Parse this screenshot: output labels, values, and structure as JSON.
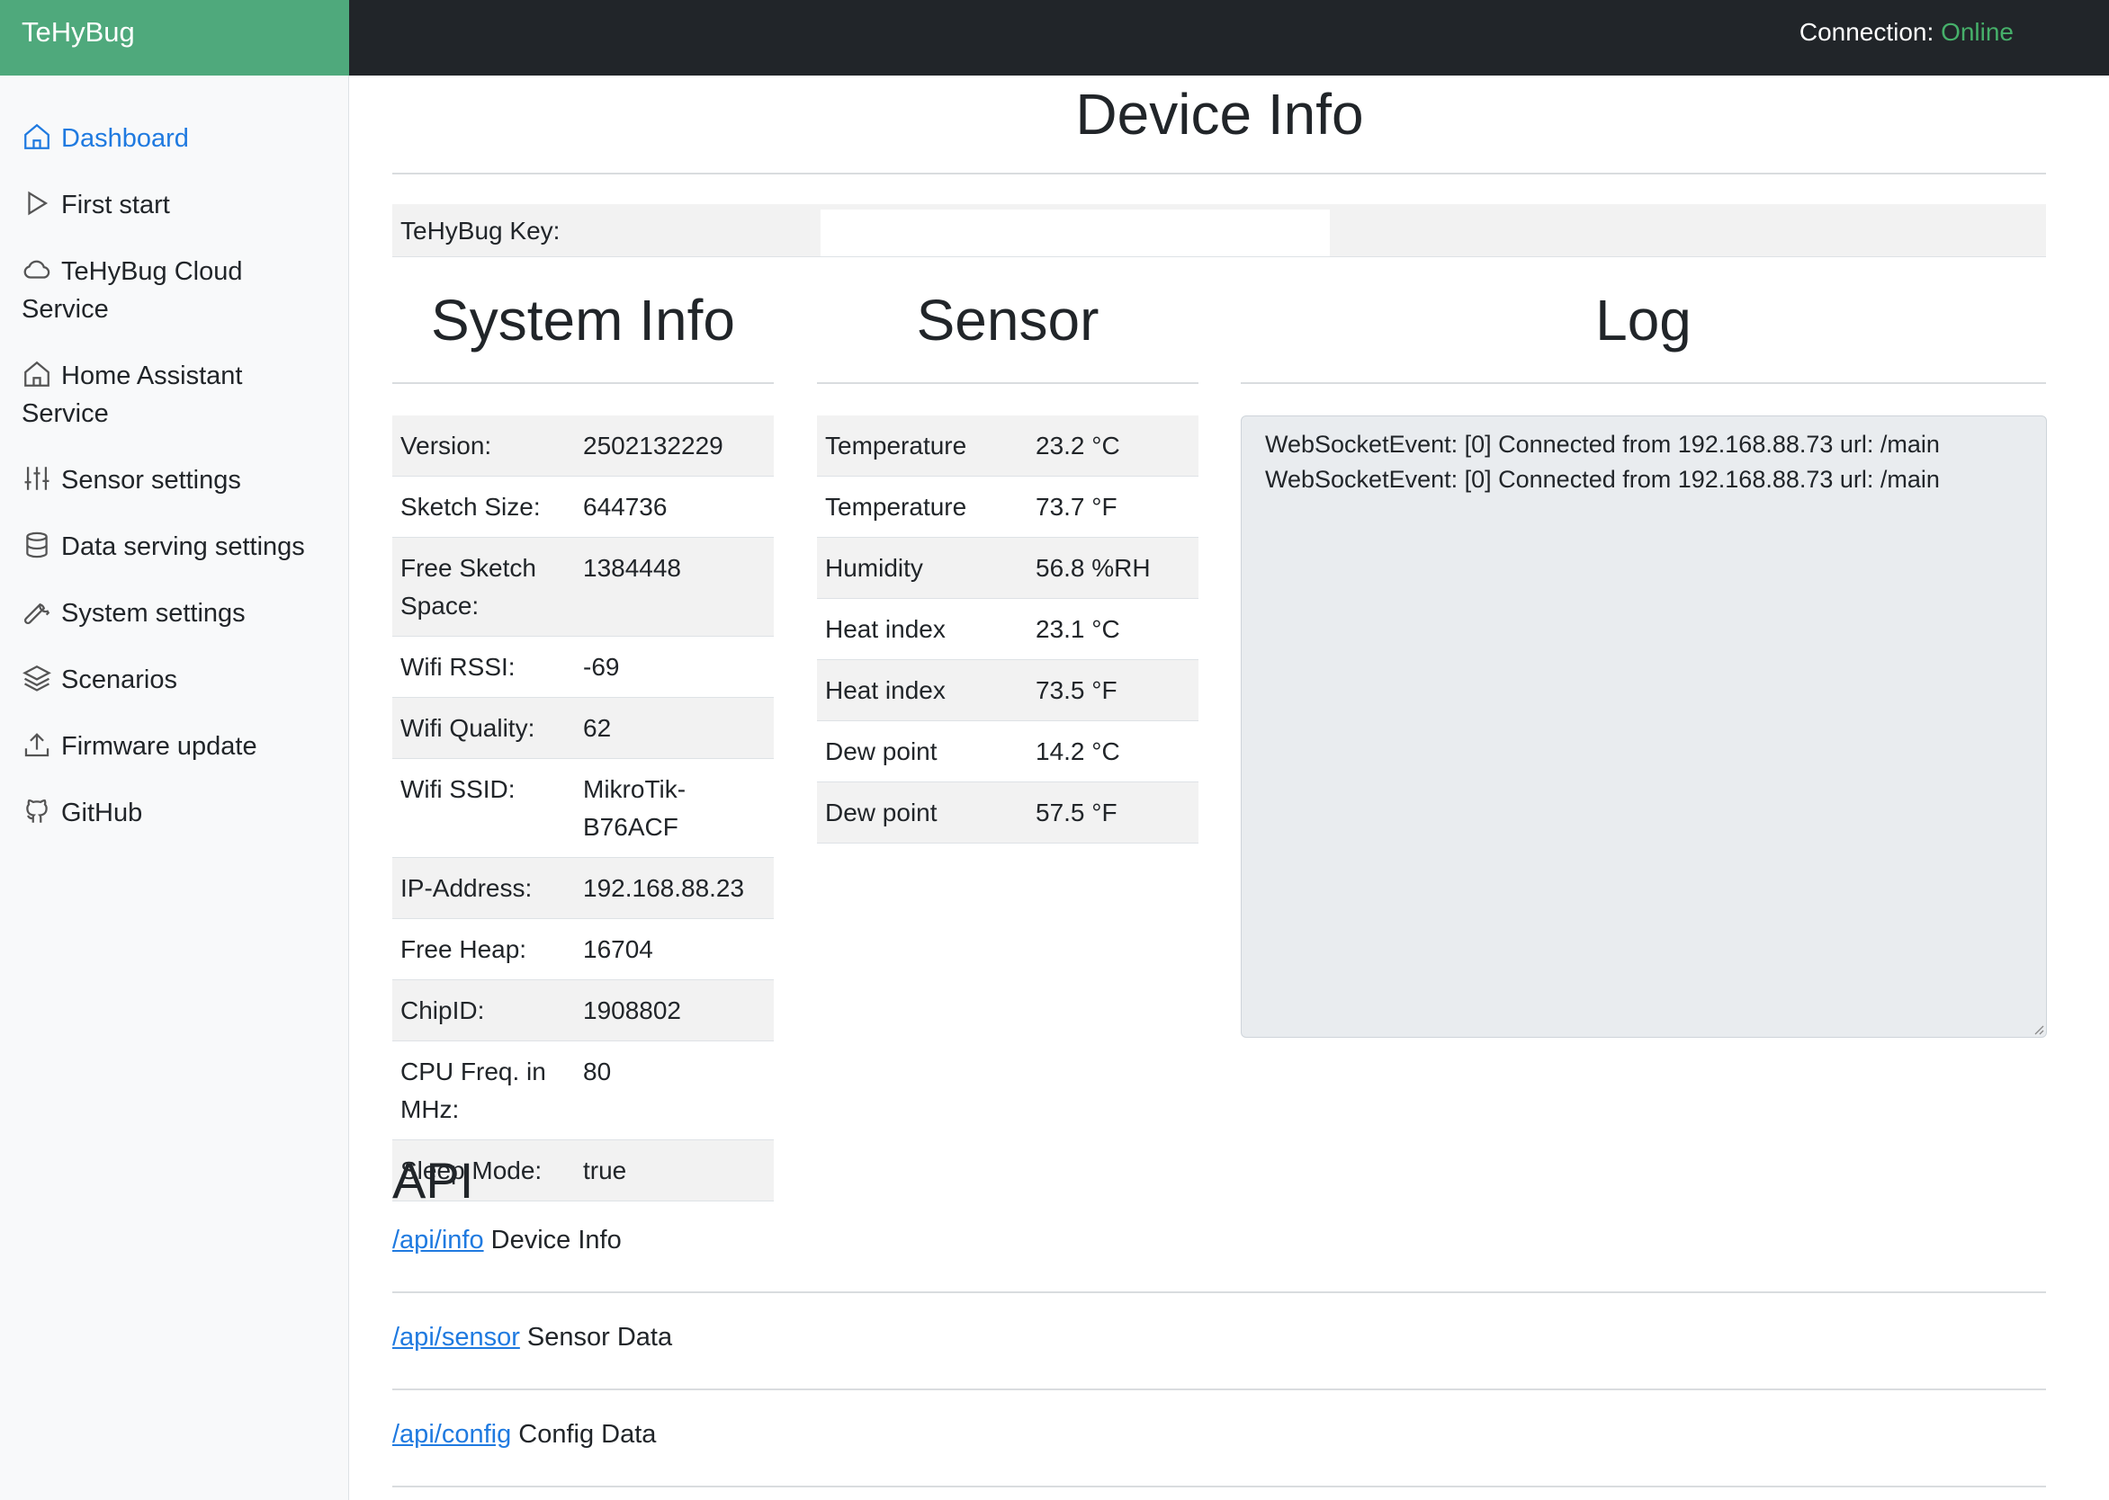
{
  "header": {
    "brand": "TeHyBug",
    "connection_label": "Connection:",
    "connection_status": "Online",
    "status_color": "#46b06a"
  },
  "sidebar": {
    "items": [
      {
        "label": "Dashboard",
        "icon": "home-icon",
        "active": true
      },
      {
        "label": "First start",
        "icon": "play-icon"
      },
      {
        "label_line1": "TeHyBug Cloud",
        "label_line2": "Service",
        "icon": "cloud-icon"
      },
      {
        "label_line1": "Home Assistant",
        "label_line2": "Service",
        "icon": "home-icon"
      },
      {
        "label": "Sensor settings",
        "icon": "sliders-icon"
      },
      {
        "label": "Data serving settings",
        "icon": "database-icon"
      },
      {
        "label": "System settings",
        "icon": "wrench-icon"
      },
      {
        "label": "Scenarios",
        "icon": "layers-icon"
      },
      {
        "label": "Firmware update",
        "icon": "upload-icon"
      },
      {
        "label": "GitHub",
        "icon": "github-icon"
      }
    ]
  },
  "main": {
    "title": "Device Info",
    "key_label": "TeHyBug Key:",
    "system_info": {
      "title": "System Info",
      "rows": [
        {
          "label": "Version:",
          "value": "2502132229"
        },
        {
          "label": "Sketch Size:",
          "value": "644736"
        },
        {
          "label_line1": "Free Sketch",
          "label_line2": "Space:",
          "value": "1384448"
        },
        {
          "label": "Wifi RSSI:",
          "value": "-69"
        },
        {
          "label": "Wifi Quality:",
          "value": "62"
        },
        {
          "label": "Wifi SSID:",
          "value_line1": "MikroTik-",
          "value_line2": "B76ACF"
        },
        {
          "label": "IP-Address:",
          "value": "192.168.88.23"
        },
        {
          "label": "Free Heap:",
          "value": "16704"
        },
        {
          "label": "ChipID:",
          "value": "1908802"
        },
        {
          "label_line1": "CPU Freq. in",
          "label_line2": "MHz:",
          "value": "80"
        },
        {
          "label": "Sleep Mode:",
          "value": "true"
        }
      ]
    },
    "sensor": {
      "title": "Sensor",
      "rows": [
        {
          "label": "Temperature",
          "value": "23.2 °C"
        },
        {
          "label": "Temperature",
          "value": "73.7 °F"
        },
        {
          "label": "Humidity",
          "value": "56.8 %RH"
        },
        {
          "label": "Heat index",
          "value": "23.1 °C"
        },
        {
          "label": "Heat index",
          "value": "73.5 °F"
        },
        {
          "label": "Dew point",
          "value": "14.2 °C"
        },
        {
          "label": "Dew point",
          "value": "57.5 °F"
        }
      ]
    },
    "log": {
      "title": "Log",
      "lines": [
        "WebSocketEvent: [0] Connected from 192.168.88.73 url: /main",
        "WebSocketEvent: [0] Connected from 192.168.88.73 url: /main"
      ]
    },
    "api": {
      "title": "API",
      "rows": [
        {
          "link": "/api/info",
          "text": " Device Info"
        },
        {
          "link": "/api/sensor",
          "text": " Sensor Data"
        },
        {
          "link": "/api/config",
          "text": " Config Data"
        }
      ]
    }
  }
}
